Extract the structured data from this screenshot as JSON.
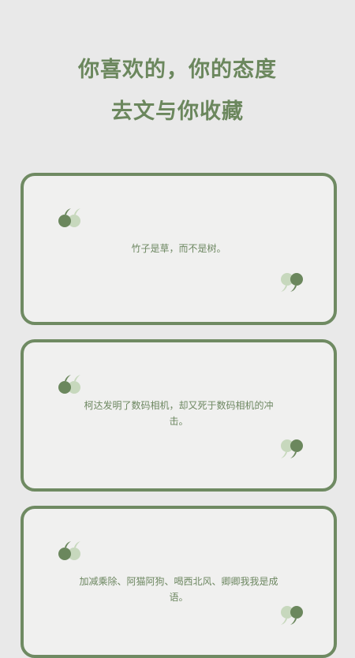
{
  "header": {
    "line1": "你喜欢的，你的态度",
    "line2": "去文与你收藏"
  },
  "cards": [
    {
      "text": "竹子是草，而不是树。"
    },
    {
      "text": "柯达发明了数码相机，却又死于数码相机的冲击。"
    },
    {
      "text": "加减乘除、阿猫阿狗、喝西北风、卿卿我我是成语。"
    }
  ],
  "colors": {
    "background": "#e9e9e9",
    "accent": "#6f8a62",
    "accent_light": "#c7d8bd",
    "card_bg": "#f0f0ef"
  },
  "icons": {
    "open": "open-quote-icon",
    "close": "close-quote-icon"
  }
}
